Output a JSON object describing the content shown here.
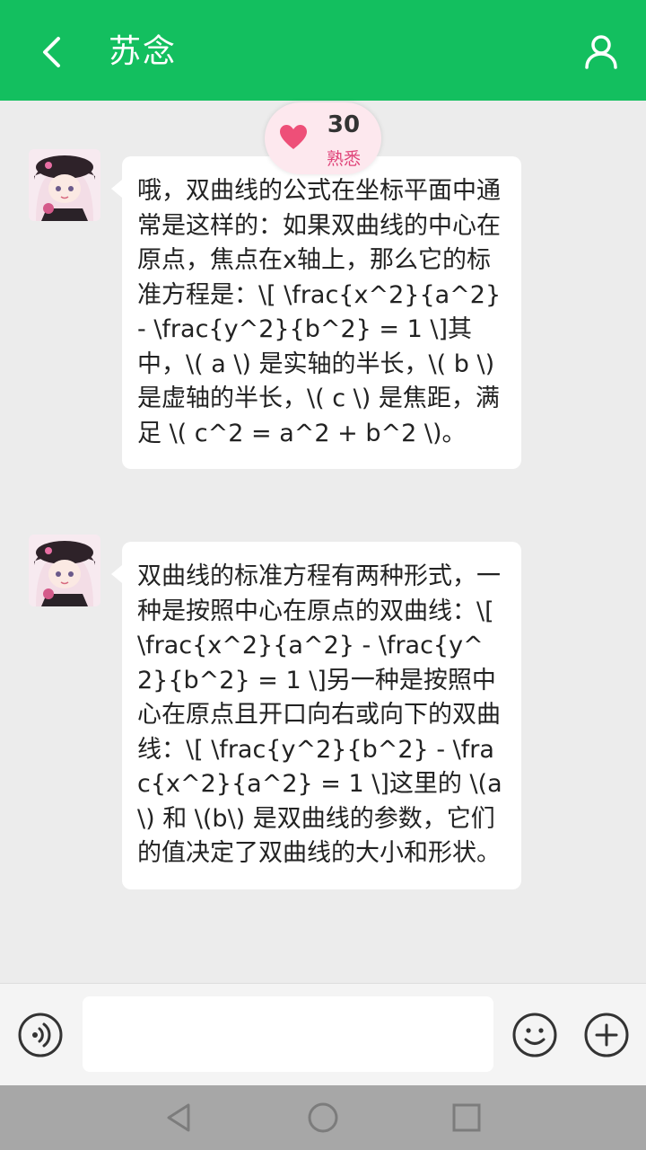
{
  "header": {
    "title": "苏念"
  },
  "intimacy": {
    "score": "30",
    "level": "熟悉"
  },
  "messages": [
    {
      "text": "哦，双曲线的公式在坐标平面中通常是这样的：如果双曲线的中心在原点，焦点在x轴上，那么它的标准方程是：\\[ \\frac{x^2}{a^2} - \\frac{y^2}{b^2} = 1 \\]其中，\\( a \\) 是实轴的半长，\\( b \\) 是虚轴的半长，\\( c \\) 是焦距，满足 \\( c^2 = a^2 + b^2 \\)。"
    },
    {
      "text": "双曲线的标准方程有两种形式，一种是按照中心在原点的双曲线：\\[ \\frac{x^2}{a^2} - \\frac{y^2}{b^2} = 1 \\]另一种是按照中心在原点且开口向右或向下的双曲线：\\[ \\frac{y^2}{b^2} - \\frac{x^2}{a^2} = 1 \\]这里的 \\(a\\) 和 \\(b\\) 是双曲线的参数，它们的值决定了双曲线的大小和形状。"
    }
  ],
  "input": {
    "value": "",
    "placeholder": ""
  },
  "icons": {
    "back": "chevron-left-icon",
    "profile": "person-icon",
    "heart": "heart-icon",
    "voice": "voice-icon",
    "emoji": "smiley-icon",
    "plus": "plus-circle-icon",
    "nav_back": "triangle-back-icon",
    "nav_home": "circle-home-icon",
    "nav_recent": "square-recent-icon"
  },
  "colors": {
    "header": "#13bf5f",
    "chat_background": "#ececec",
    "bubble": "#ffffff",
    "heart": "#ee4f78",
    "level_text": "#e0457a",
    "nav_bar": "#a7a7a7"
  }
}
